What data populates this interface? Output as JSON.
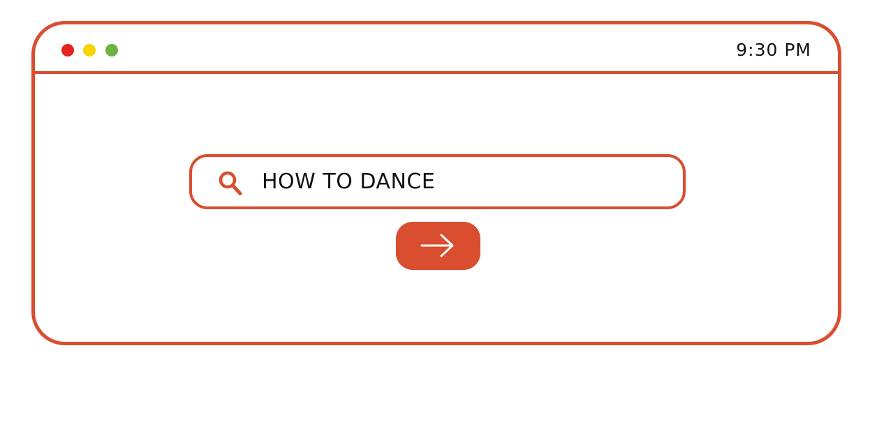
{
  "titlebar": {
    "time": "9:30 PM",
    "dots": [
      {
        "name": "close",
        "color": "#e52320"
      },
      {
        "name": "minimize",
        "color": "#f7d500"
      },
      {
        "name": "maximize",
        "color": "#6cb33f"
      }
    ]
  },
  "search": {
    "icon": "search-icon",
    "query": "HOW TO DANCE"
  },
  "submit": {
    "icon": "arrow-right-icon"
  },
  "colors": {
    "accent": "#d94e2f",
    "text": "#111111",
    "background": "#ffffff"
  }
}
